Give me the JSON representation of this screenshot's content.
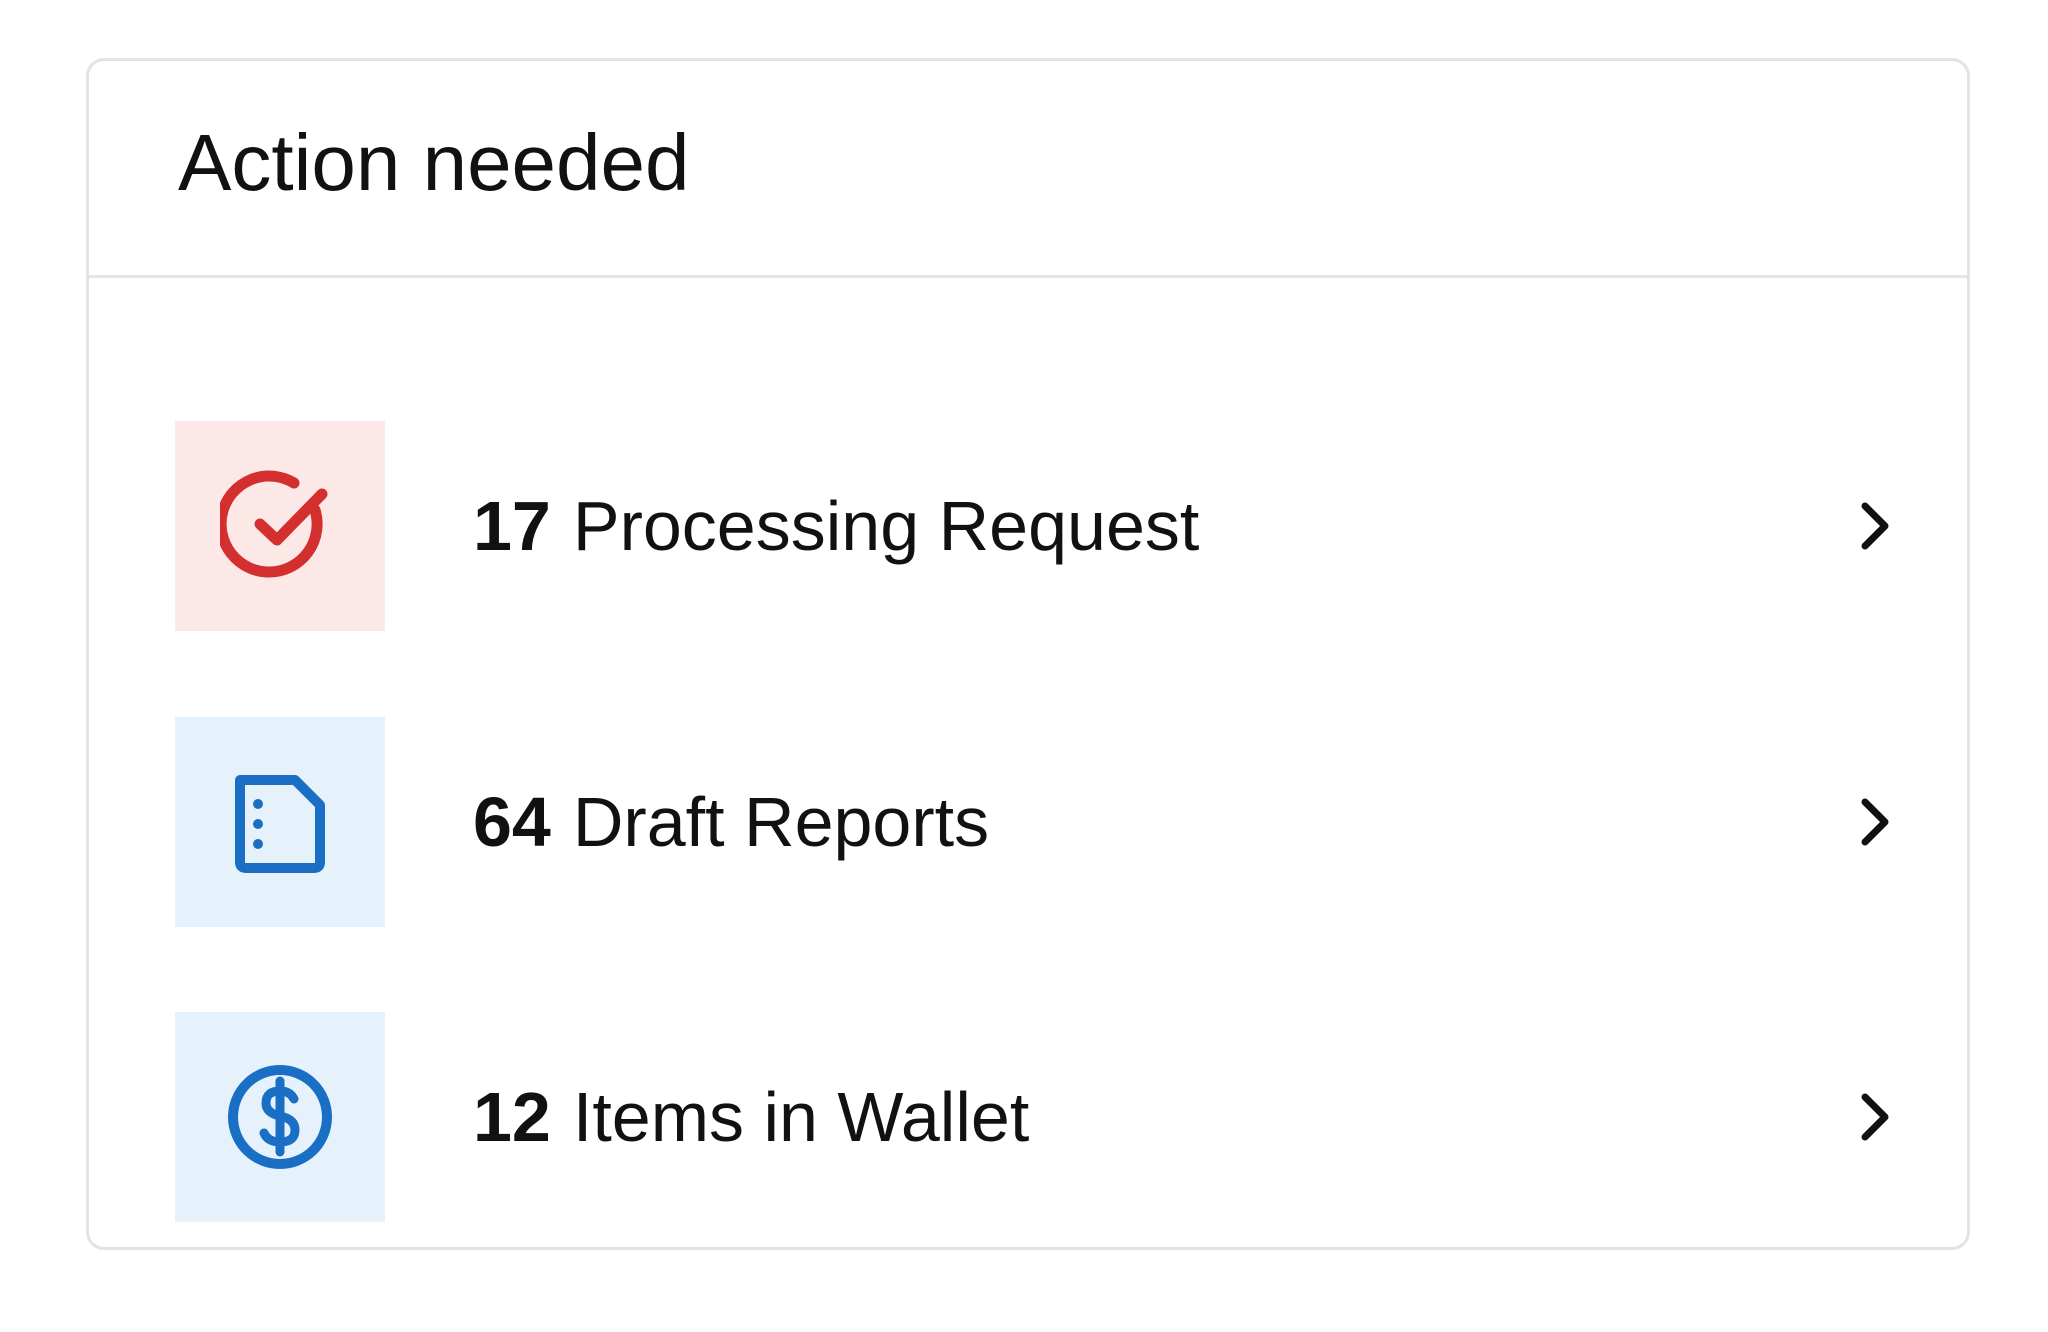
{
  "card": {
    "title": "Action needed"
  },
  "items": [
    {
      "count": "17",
      "label": "Processing Request",
      "icon": "check-circle-icon",
      "tile_color": "#fde8e8",
      "icon_color": "#d32f2f"
    },
    {
      "count": "64",
      "label": "Draft Reports",
      "icon": "document-icon",
      "tile_color": "#e5f2fc",
      "icon_color": "#1a6fc4"
    },
    {
      "count": "12",
      "label": "Items in Wallet",
      "icon": "dollar-circle-icon",
      "tile_color": "#e5f2fc",
      "icon_color": "#1a6fc4"
    }
  ],
  "chevron_icon": "chevron-right-icon"
}
